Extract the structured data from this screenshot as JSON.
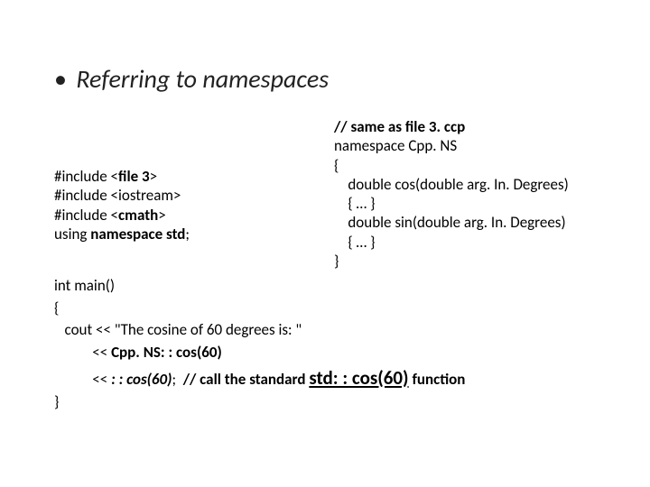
{
  "title": {
    "bullet": "•",
    "text": "Referring to namespaces"
  },
  "left": {
    "inc1_pre": "#include <",
    "inc1_bold": "file 3",
    "inc1_post": ">",
    "inc2": "#include <iostream>",
    "inc3_pre": "#include <",
    "inc3_bold": "cmath",
    "inc3_post": ">",
    "using_pre": "using ",
    "using_bold": "namespace std",
    "using_post": ";"
  },
  "right": {
    "comment": "// same as file 3. ccp",
    "ns": "namespace Cpp. NS",
    "open": "{",
    "cos": "    double cos(double arg. In. Degrees)",
    "cos_body": "    { … }",
    "sin": "    double sin(double arg. In. Degrees)",
    "sin_body": "    { … }",
    "close": "}"
  },
  "main": {
    "l1": "int main()",
    "l2": "{",
    "l3": "   cout << \"The cosine of 60 degrees is: \"",
    "l4_pre": "           << ",
    "l4_bold": "Cpp. NS: : cos(60)",
    "l5_pre": "           << ",
    "l5_bolditalic": ": : cos(60)",
    "l5_semi": "; ",
    "l5_comment": " // call the standard ",
    "l5_std": "std: : cos(60)",
    "l5_fn": " function",
    "l6": "}"
  }
}
